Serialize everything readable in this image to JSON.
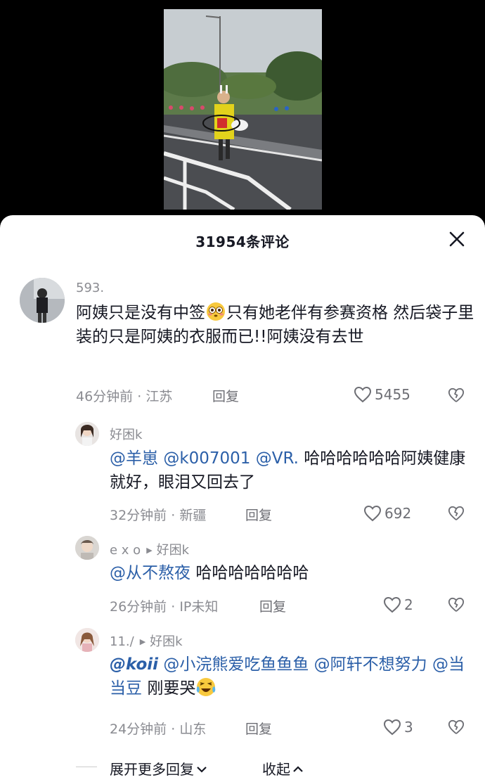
{
  "header": {
    "title": "31954条评论"
  },
  "comments": [
    {
      "user": "593.",
      "text_parts": [
        "阿姨只是没有中签",
        "只有她老伴有参赛资格  然后袋子里装的只是阿姨的衣服而已!!阿姨没有去世"
      ],
      "time": "46分钟前",
      "location": "江苏",
      "reply": "回复",
      "likes": "5455"
    },
    {
      "user": "好困k",
      "mentions": [
        "@羊崽",
        "@k007001",
        "@VR."
      ],
      "text": "哈哈哈哈哈哈阿姨健康就好，眼泪又回去了",
      "time": "32分钟前",
      "location": "新疆",
      "reply": "回复",
      "likes": "692"
    },
    {
      "user": "e x o",
      "reply_to": "好困k",
      "mention": "@从不熬夜",
      "text": "哈哈哈哈哈哈哈",
      "time": "26分钟前",
      "location": "IP未知",
      "reply": "回复",
      "likes": "2"
    },
    {
      "user": "11./",
      "reply_to": "好困k",
      "mentions": [
        "@koii",
        "@小浣熊爱吃鱼鱼鱼",
        "@阿轩不想努力",
        "@当当豆"
      ],
      "text": "刚要哭",
      "time": "24分钟前",
      "location": "山东",
      "reply": "回复",
      "likes": "3"
    }
  ],
  "footer": {
    "expand": "展开更多回复",
    "collapse": "收起"
  },
  "icons": [
    "close-icon",
    "heart-icon",
    "broken-heart-icon",
    "chevron-down-icon",
    "chevron-up-icon",
    "flushed-emoji",
    "crying-laughing-emoji"
  ]
}
